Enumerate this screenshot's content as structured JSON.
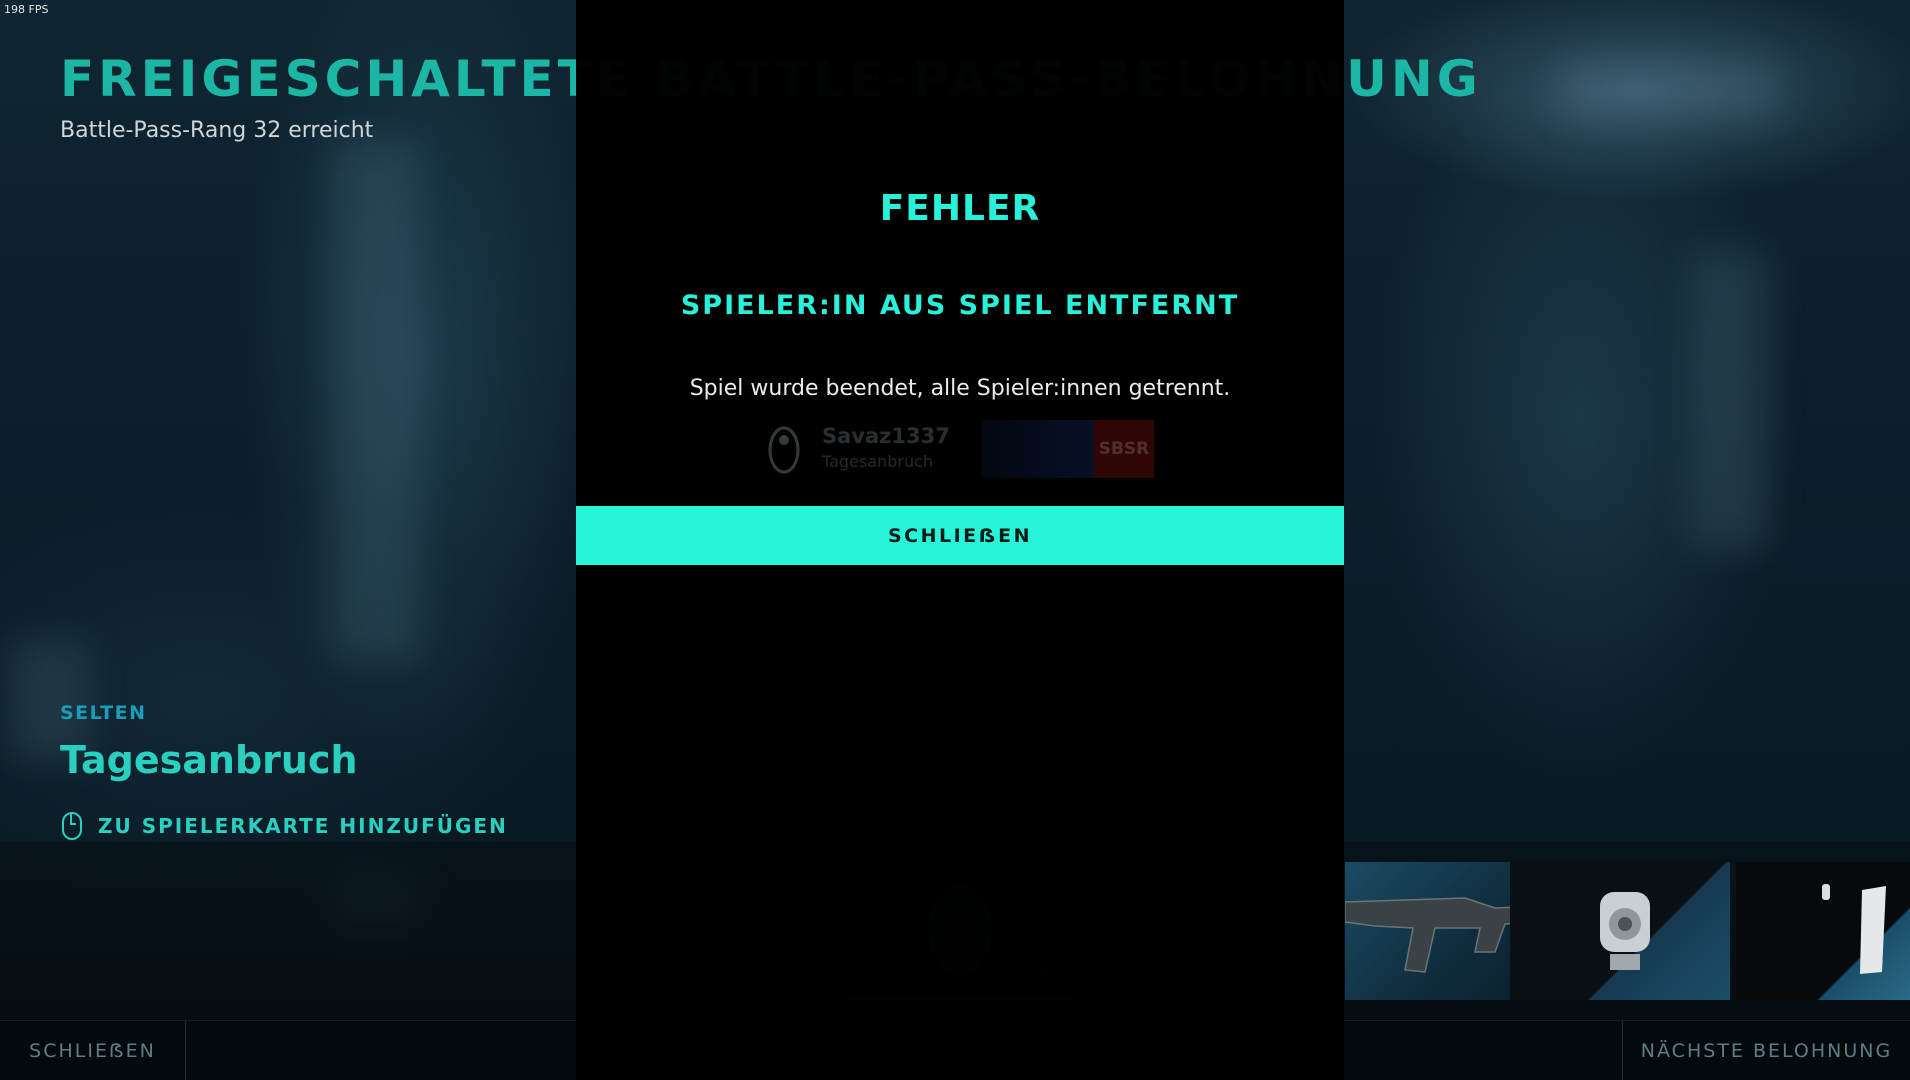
{
  "fps": "198 FPS",
  "page": {
    "title": "FREIGESCHALTETE BATTLE-PASS-BELOHNUNG",
    "subtitle": "Battle-Pass-Rang 32 erreicht"
  },
  "item": {
    "rarity": "SELTEN",
    "name": "Tagesanbruch",
    "add_to_card_label": "ZU SPIELERKARTE HINZUFÜGEN"
  },
  "modal": {
    "title": "FEHLER",
    "subtitle": "SPIELER:IN AUS SPIEL ENTFERNT",
    "message": "Spiel wurde beendet, alle Spieler:innen getrennt.",
    "button_label": "SCHLIEẞEN"
  },
  "player_card": {
    "name": "Savaz1337",
    "subtitle": "Tagesanbruch",
    "rank": "SBSR"
  },
  "rewards": [
    {
      "icon": "emblem-icon",
      "active": true
    },
    {
      "icon": "weapon-skin-icon"
    },
    {
      "icon": "rifle-icon"
    },
    {
      "icon": "scope-icon"
    },
    {
      "icon": "magazine-icon"
    }
  ],
  "bottombar": {
    "close_label": "SCHLIEẞEN",
    "next_label": "NÄCHSTE BELOHNUNG"
  },
  "colors": {
    "accent": "#28fadb",
    "title_teal": "#1bb7a4",
    "rarity_blue": "#1e9dbb"
  }
}
